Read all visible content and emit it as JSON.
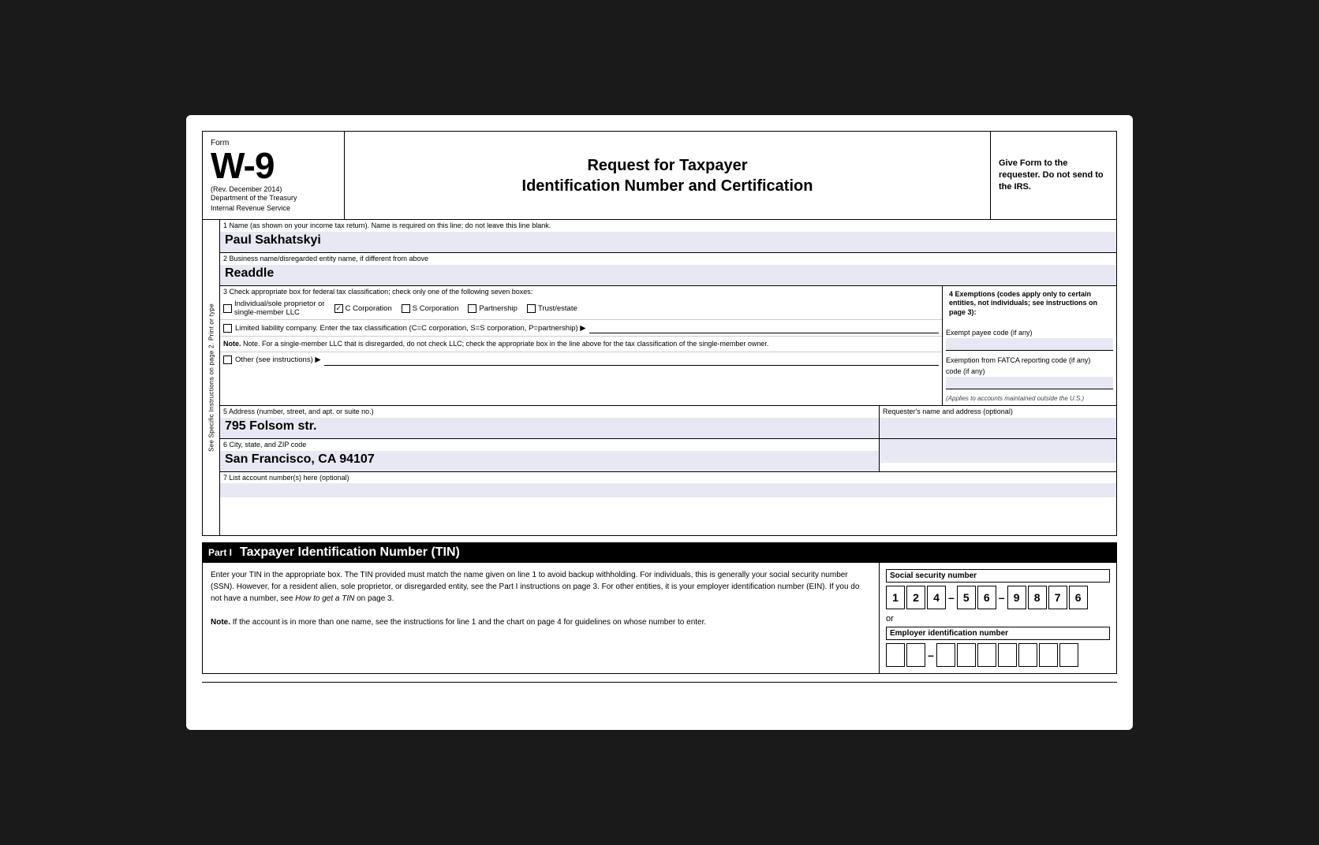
{
  "header": {
    "form_label": "Form",
    "form_number": "W-9",
    "rev": "(Rev. December 2014)",
    "dept1": "Department of the Treasury",
    "dept2": "Internal Revenue Service",
    "title_line1": "Request for Taxpayer",
    "title_line2": "Identification Number and Certification",
    "give_form": "Give Form to the requester. Do not send to the IRS."
  },
  "fields": {
    "field1_label": "1  Name (as shown on your income tax return). Name is required on this line; do not leave this line blank.",
    "field1_value": "Paul Sakhatskyi",
    "field2_label": "2  Business name/disregarded entity name, if different from above",
    "field2_value": "Readdle",
    "field3_label": "3  Check appropriate box for federal tax classification; check only one of the following seven boxes:",
    "field4_label": "4  Exemptions (codes apply only to certain entities, not individuals; see instructions on page 3):",
    "exempt_payee_label": "Exempt payee code (if any)",
    "fatca_label": "Exemption from FATCA reporting code (if any)",
    "fatca_note": "(Applies to accounts maintained outside the U.S.)",
    "checkboxes": [
      {
        "id": "individual",
        "label": "Individual/sole proprietor or single-member LLC",
        "checked": false
      },
      {
        "id": "c_corp",
        "label": "C Corporation",
        "checked": true
      },
      {
        "id": "s_corp",
        "label": "S Corporation",
        "checked": false
      },
      {
        "id": "partnership",
        "label": "Partnership",
        "checked": false
      },
      {
        "id": "trust",
        "label": "Trust/estate",
        "checked": false
      }
    ],
    "llc_label": "Limited liability company. Enter the tax classification (C=C corporation, S=S corporation, P=partnership) ▶",
    "note_text": "Note. For a single-member LLC that is disregarded, do not check LLC; check the appropriate box in the line above for the tax classification of the single-member owner.",
    "other_label": "Other (see instructions) ▶",
    "field5_label": "5  Address (number, street, and apt. or suite no.)",
    "field5_value": "795 Folsom str.",
    "requester_label": "Requester's name and address (optional)",
    "field6_label": "6  City, state, and ZIP code",
    "field6_value": "San Francisco, CA 94107",
    "field7_label": "7  List account number(s) here (optional)",
    "side_label": "See Specific Instructions on page 2.          Print or type"
  },
  "part1": {
    "part_label": "Part I",
    "part_title": "Taxpayer Identification Number (TIN)",
    "body_text1": "Enter your TIN in the appropriate box. The TIN provided must match the name given on line 1 to avoid backup withholding. For individuals, this is generally your social security number (SSN). However, for a resident alien, sole proprietor, or disregarded entity, see the Part I instructions on page 3. For other entities, it is your employer identification number (EIN). If you do not have a number, see How to get a TIN on page 3.",
    "body_text2": "Note. If the account is in more than one name, see the instructions for line 1 and the chart on page 4 for guidelines on whose number to enter.",
    "ssn_label": "Social security number",
    "ssn_digits": [
      "1",
      "2",
      "4",
      "",
      "5",
      "6",
      "",
      "9",
      "8",
      "7",
      "6"
    ],
    "or_text": "or",
    "ein_label": "Employer identification number",
    "ein_digits": [
      "",
      "",
      "",
      "",
      "",
      "",
      "",
      "",
      ""
    ]
  }
}
